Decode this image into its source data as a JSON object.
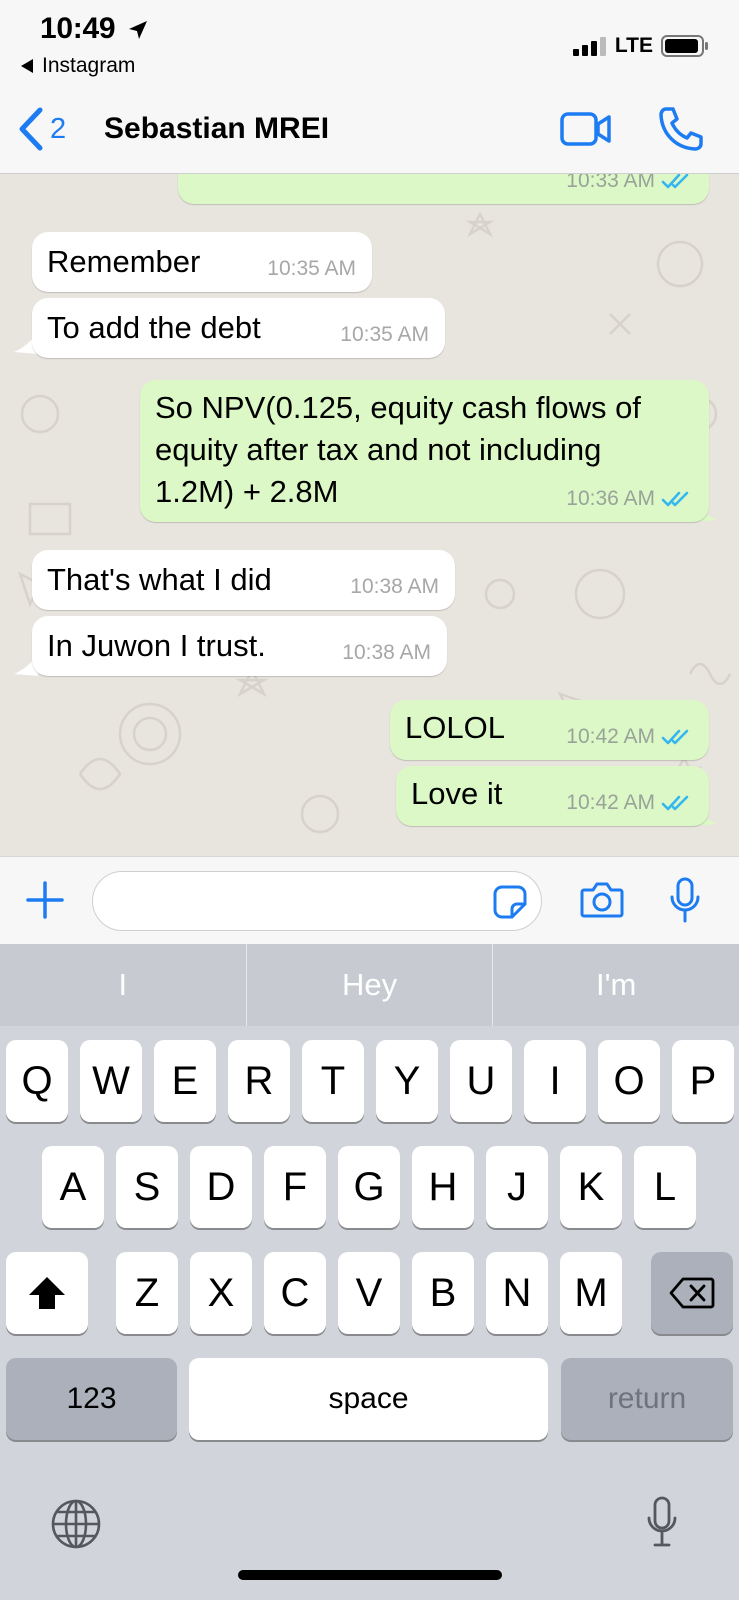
{
  "status_bar": {
    "time": "10:49",
    "back_app": "Instagram",
    "network": "LTE"
  },
  "nav": {
    "back_count": "2",
    "title": "Sebastian MREI"
  },
  "messages": [
    {
      "direction": "out",
      "text": "",
      "time": "10:33 AM",
      "read": true
    },
    {
      "direction": "in",
      "text": "Remember",
      "time": "10:35 AM"
    },
    {
      "direction": "in",
      "text": "To add the debt",
      "time": "10:35 AM"
    },
    {
      "direction": "out",
      "lines": [
        "So NPV(0.125, equity cash flows of",
        "equity after tax and not including",
        "1.2M) + 2.8M"
      ],
      "time": "10:36 AM",
      "read": true
    },
    {
      "direction": "in",
      "text": "That's what I did",
      "time": "10:38 AM"
    },
    {
      "direction": "in",
      "text": "In Juwon I trust.",
      "time": "10:38 AM"
    },
    {
      "direction": "out",
      "text": "LOLOL",
      "time": "10:42 AM",
      "read": true
    },
    {
      "direction": "out",
      "text": "Love it",
      "time": "10:42 AM",
      "read": true
    }
  ],
  "input": {
    "value": "",
    "placeholder": ""
  },
  "keyboard": {
    "suggestions": [
      "I",
      "Hey",
      "I'm"
    ],
    "row1": [
      "Q",
      "W",
      "E",
      "R",
      "T",
      "Y",
      "U",
      "I",
      "O",
      "P"
    ],
    "row2": [
      "A",
      "S",
      "D",
      "F",
      "G",
      "H",
      "J",
      "K",
      "L"
    ],
    "row3": [
      "Z",
      "X",
      "C",
      "V",
      "B",
      "N",
      "M"
    ],
    "numbers_label": "123",
    "space_label": "space",
    "return_label": "return"
  },
  "colors": {
    "accent": "#1d7cf2",
    "outgoing_bubble": "#dcf8c6",
    "incoming_bubble": "#ffffff",
    "read_receipt": "#34b7f1",
    "chat_background": "#e8e4de"
  },
  "icons": [
    "location-arrow-icon",
    "back-triangle-icon",
    "signal-icon",
    "battery-icon",
    "chevron-left-icon",
    "video-call-icon",
    "phone-icon",
    "plus-icon",
    "sticker-icon",
    "camera-icon",
    "microphone-icon",
    "shift-icon",
    "backspace-icon",
    "globe-icon"
  ]
}
